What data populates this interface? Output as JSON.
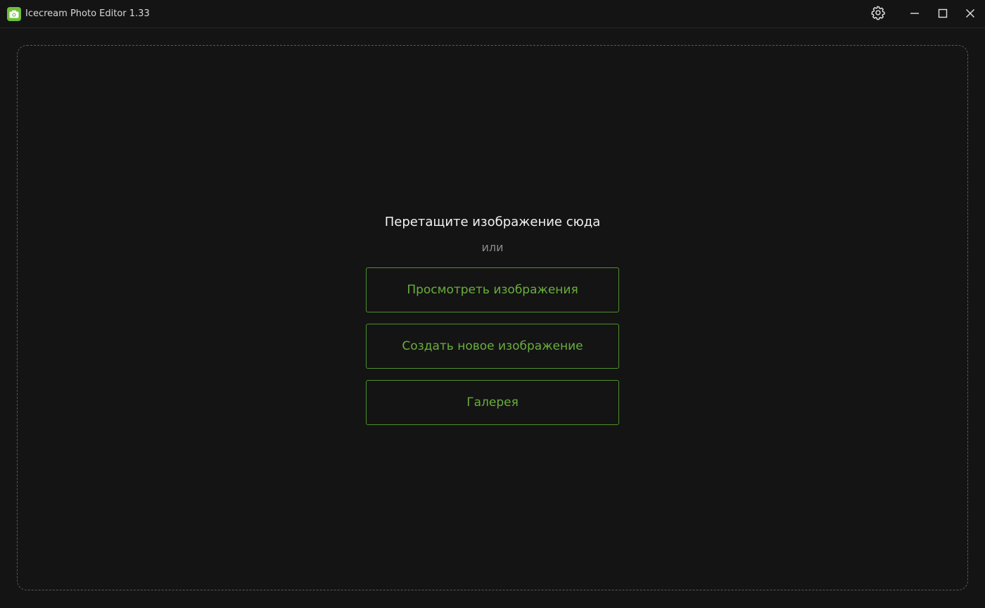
{
  "window": {
    "title": "Icecream Photo Editor 1.33"
  },
  "titlebar": {
    "app_icon": "camera-icon",
    "settings_icon": "gear-icon",
    "minimize_icon": "minimize-icon",
    "maximize_icon": "maximize-icon",
    "close_icon": "close-icon"
  },
  "main": {
    "drop_title": "Перетащите изображение сюда",
    "or_label": "или",
    "buttons": [
      {
        "label": "Просмотреть изображения"
      },
      {
        "label": "Создать новое изображение"
      },
      {
        "label": "Галерея"
      }
    ]
  },
  "colors": {
    "background": "#141414",
    "accent": "#6aae3c",
    "accent_border": "#4f8f2a",
    "app_icon_bg": "#6fbf3a"
  }
}
